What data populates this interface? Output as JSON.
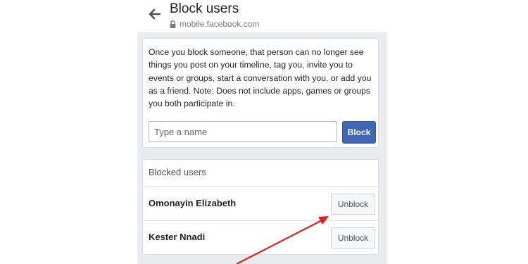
{
  "header": {
    "title": "Block users",
    "url": "mobile.facebook.com"
  },
  "block_form": {
    "description": "Once you block someone, that person can no longer see things you post on your timeline, tag you, invite you to events or groups, start a conversation with you, or add you as a friend. Note: Does not include apps, games or groups you both participate in.",
    "input_placeholder": "Type a name",
    "input_value": "",
    "block_label": "Block"
  },
  "blocked": {
    "title": "Blocked users",
    "users": [
      {
        "name": "Omonayin Elizabeth",
        "action": "Unblock"
      },
      {
        "name": "Kester Nnadi",
        "action": "Unblock"
      }
    ]
  },
  "colors": {
    "primary_button": "#4267b2",
    "background": "#e9ebee",
    "annotation_arrow": "#e0201b"
  }
}
